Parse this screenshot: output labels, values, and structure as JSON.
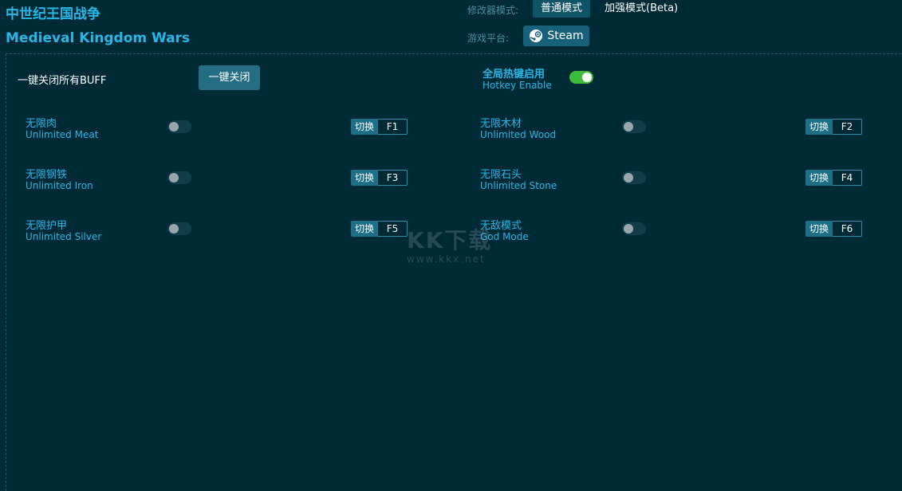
{
  "app": {
    "title_cn": "中世纪王国战争",
    "title_en": "Medieval Kingdom Wars"
  },
  "mode": {
    "label": "修改器模式:",
    "normal": "普通模式",
    "beta": "加强模式(Beta)",
    "selected": "普通模式"
  },
  "platform": {
    "label": "游戏平台:",
    "name": "Steam"
  },
  "buff": {
    "label": "一键关闭所有BUFF",
    "button": "一键关闭"
  },
  "hotkey": {
    "label_cn": "全局热键启用",
    "label_en": "Hotkey Enable",
    "enabled": true
  },
  "switch_label": "切换",
  "cheats": [
    {
      "cn": "无限肉",
      "en": "Unlimited Meat",
      "key": "F1",
      "enabled": false
    },
    {
      "cn": "无限木材",
      "en": "Unlimited Wood",
      "key": "F2",
      "enabled": false
    },
    {
      "cn": "无限钢铁",
      "en": "Unlimited Iron",
      "key": "F3",
      "enabled": false
    },
    {
      "cn": "无限石头",
      "en": "Unlimited Stone",
      "key": "F4",
      "enabled": false
    },
    {
      "cn": "无限护甲",
      "en": "Unlimited Silver",
      "key": "F5",
      "enabled": false
    },
    {
      "cn": "无敌模式",
      "en": "God Mode",
      "key": "F6",
      "enabled": false
    }
  ],
  "watermark": {
    "logo": "KK下载",
    "url": "www.kkx.net"
  },
  "colors": {
    "background": "#002a35",
    "accent": "#29b6e6",
    "toggle_on": "#3dbb3a"
  }
}
